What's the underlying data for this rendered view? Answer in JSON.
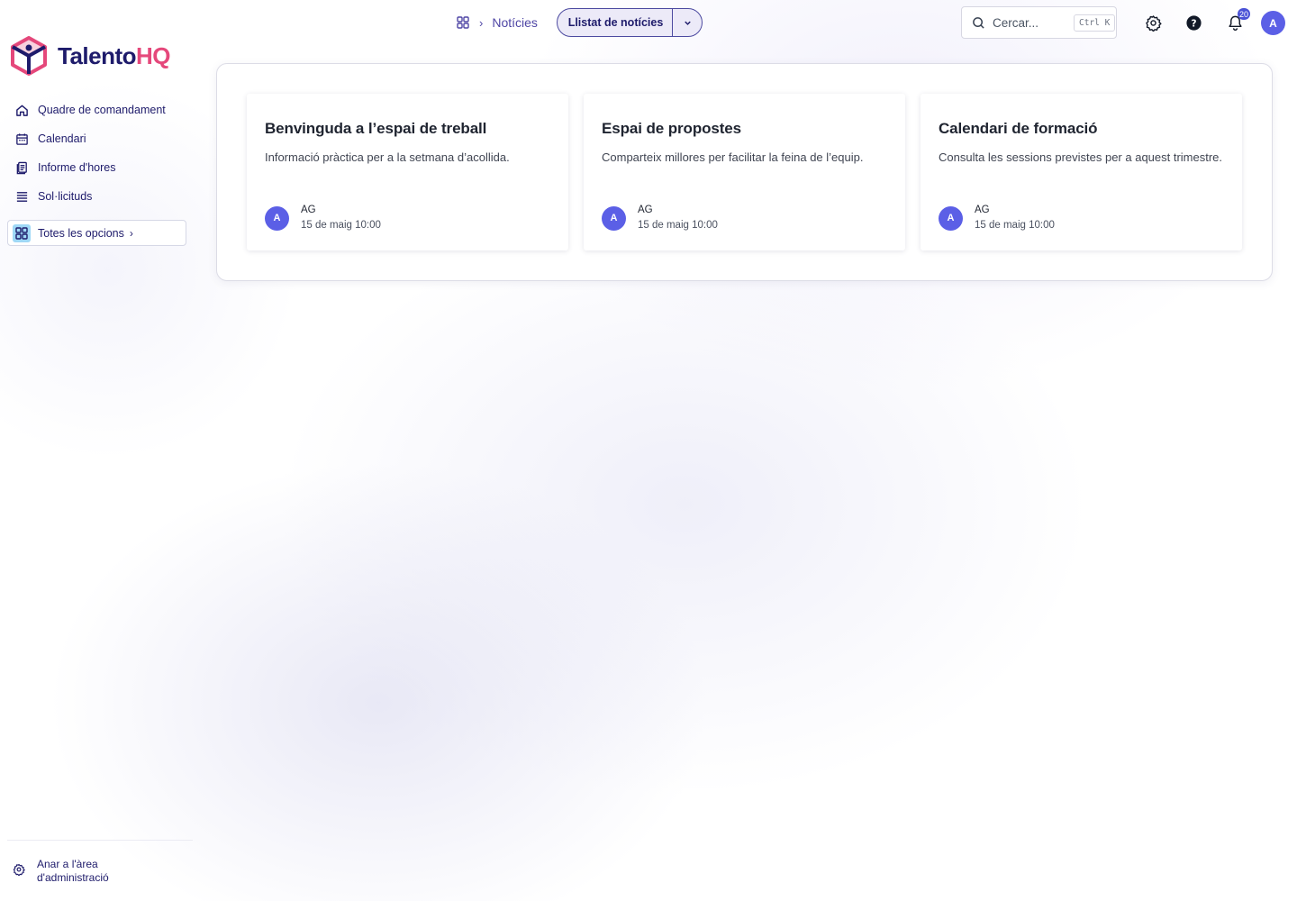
{
  "brand": {
    "name_part1": "Talento",
    "name_part2": "HQ",
    "color_primary": "#1e1b6b",
    "color_accent": "#e5487b"
  },
  "sidebar": {
    "items": [
      {
        "label": "Quadre de comandament",
        "icon": "home-icon"
      },
      {
        "label": "Calendari",
        "icon": "calendar-icon"
      },
      {
        "label": "Informe d'hores",
        "icon": "report-icon"
      },
      {
        "label": "Sol·licituds",
        "icon": "list-icon"
      }
    ],
    "all_options": {
      "label": "Totes les opcions",
      "icon": "grid-icon"
    },
    "admin": {
      "line1": "Anar a l'àrea",
      "line2": "d'administració",
      "icon": "gear-icon"
    }
  },
  "header": {
    "breadcrumb": {
      "current": "Notícies"
    },
    "view_select": {
      "value": "Llistat de notícies"
    },
    "search": {
      "placeholder": "Cercar...",
      "shortcut": "Ctrl K"
    },
    "notifications": {
      "count": "20"
    },
    "user_avatar": "A"
  },
  "news": {
    "cards": [
      {
        "title": "Benvinguda a l’espai de treball",
        "description": "Informació pràctica per a la setmana d’acollida.",
        "avatar": "A",
        "author": "AG",
        "date": "15 de maig 10:00"
      },
      {
        "title": "Espai de propostes",
        "description": "Comparteix millores per facilitar la feina de l’equip.",
        "avatar": "A",
        "author": "AG",
        "date": "15 de maig 10:00"
      },
      {
        "title": "Calendari de formació",
        "description": "Consulta les sessions previstes per a aquest trimestre.",
        "avatar": "A",
        "author": "AG",
        "date": "15 de maig 10:00"
      }
    ]
  }
}
